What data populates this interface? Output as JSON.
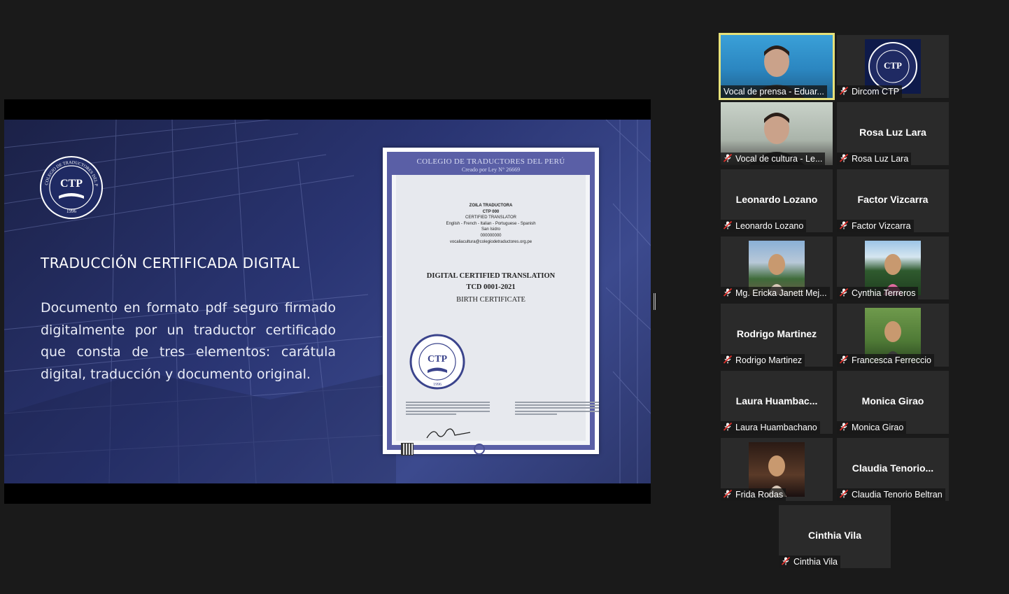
{
  "slide": {
    "title": "TRADUCCIÓN CERTIFICADA DIGITAL",
    "body": "Documento en formato pdf seguro firmado digitalmente por un traductor certificado que consta de tres elementos: carátula digital, traducción y documento original.",
    "logo_text": "COLEGIO DE TRADUCTORES DEL PERÚ",
    "logo_initials": "CTP",
    "logo_year": "1996"
  },
  "certificate": {
    "header": "COLEGIO DE TRADUCTORES DEL PERÚ",
    "subheader": "Creado por Ley N° 26669",
    "name": "ZOILA TRADUCTORA",
    "ctp": "CTP 000",
    "role": "CERTIFIED TRANSLATOR",
    "languages": "English - French - Italian - Portuguese - Spanish",
    "city": "San Isidro",
    "phone": "000000000",
    "email": "vocaliacultura@colegiodetraductores.org.pe",
    "doc_title": "DIGITAL CERTIFIED TRANSLATION",
    "doc_code": "TCD 0001-2021",
    "doc_type": "BIRTH CERTIFICATE"
  },
  "participants": [
    {
      "name": "Vocal de prensa - Eduar...",
      "display": "",
      "active": true,
      "media": "video"
    },
    {
      "name": "Dircom CTP",
      "display": "",
      "active": false,
      "media": "logo"
    },
    {
      "name": "Vocal de cultura - Le...",
      "display": "",
      "active": false,
      "media": "video"
    },
    {
      "name": "Rosa Luz Lara",
      "display": "Rosa Luz Lara",
      "active": false,
      "media": "none"
    },
    {
      "name": "Leonardo Lozano",
      "display": "Leonardo Lozano",
      "active": false,
      "media": "none"
    },
    {
      "name": "Factor Vizcarra",
      "display": "Factor Vizcarra",
      "active": false,
      "media": "none"
    },
    {
      "name": "Mg. Ericka Janett Mej...",
      "display": "",
      "active": false,
      "media": "photo"
    },
    {
      "name": "Cynthia Terreros",
      "display": "",
      "active": false,
      "media": "photo"
    },
    {
      "name": "Rodrigo Martinez",
      "display": "Rodrigo Martinez",
      "active": false,
      "media": "none"
    },
    {
      "name": "Francesca Ferreccio",
      "display": "",
      "active": false,
      "media": "photo"
    },
    {
      "name": "Laura Huambachano",
      "display": "Laura  Huambac...",
      "active": false,
      "media": "none"
    },
    {
      "name": "Monica Girao",
      "display": "Monica Girao",
      "active": false,
      "media": "none"
    },
    {
      "name": "Frida Rodas",
      "display": "",
      "active": false,
      "media": "photo"
    },
    {
      "name": "Claudia Tenorio Beltran",
      "display": "Claudia  Tenorio...",
      "active": false,
      "media": "none"
    },
    {
      "name": "Cinthia Vila",
      "display": "Cinthia Vila",
      "active": false,
      "media": "none"
    }
  ],
  "colors": {
    "background": "#1a1a1a",
    "tile": "#2a2a2a",
    "active_speaker": "#e6e17a",
    "muted_icon": "#e0302a",
    "slide_blue": "#2a3573",
    "cert_border": "#5a5fa6"
  }
}
